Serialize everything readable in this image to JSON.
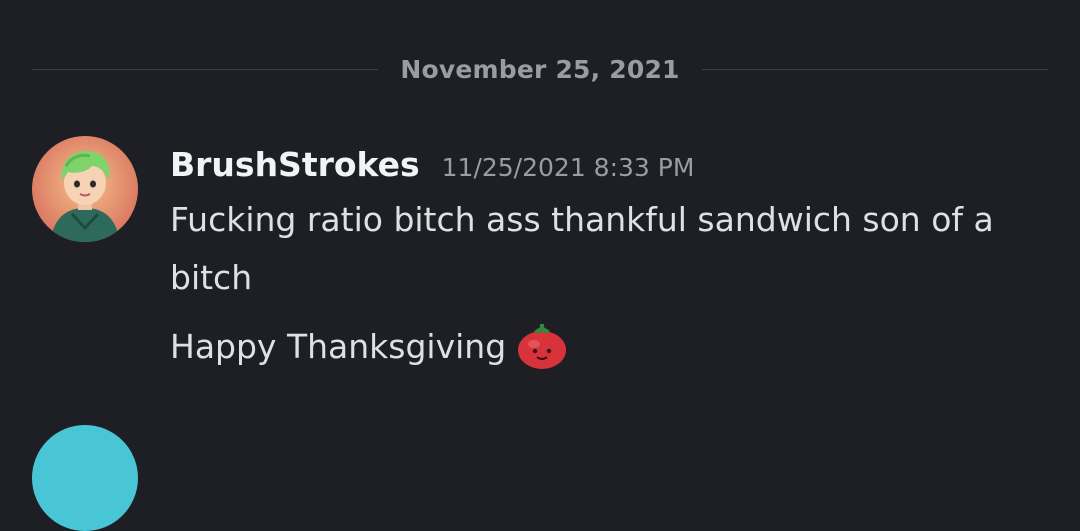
{
  "divider": {
    "date": "November 25, 2021"
  },
  "message": {
    "username": "BrushStrokes",
    "timestamp": "11/25/2021 8:33 PM",
    "line1": "Fucking ratio bitch ass thankful sandwich son of a bitch",
    "line2": "Happy Thanksgiving",
    "emoji_icon": "tomato-emoji-icon",
    "avatar_icon": "green-haired-character-avatar"
  },
  "colors": {
    "background": "#1e1f24",
    "username": "#f2f3f5",
    "message_text": "#dfe0e3",
    "muted": "#9a9ca4",
    "divider": "#3b3d44"
  }
}
